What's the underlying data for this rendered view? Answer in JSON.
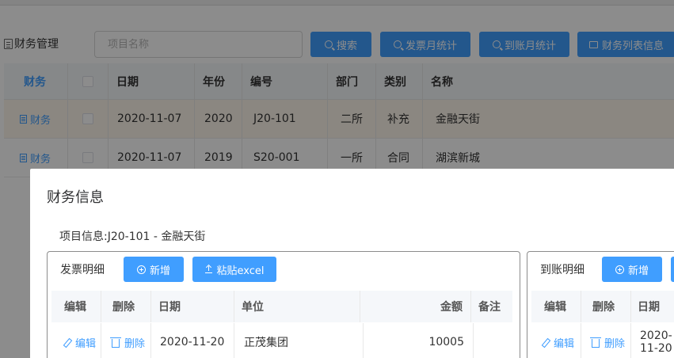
{
  "toolbar": {
    "module_title": "财务管理",
    "search_placeholder": "项目名称",
    "search_button": "搜索",
    "invoice_monthly_button": "发票月统计",
    "arrival_monthly_button": "到账月统计",
    "finance_list_button": "财务列表信息"
  },
  "main_table": {
    "headers": {
      "action": "财务",
      "date": "日期",
      "year": "年份",
      "code": "编号",
      "dept": "部门",
      "category": "类别",
      "name": "名称"
    },
    "rows": [
      {
        "action": "财务",
        "date": "2020-11-07",
        "year": "2020",
        "code": "J20-101",
        "dept": "二所",
        "category": "补充",
        "name": "金融天街"
      },
      {
        "action": "财务",
        "date": "2020-11-07",
        "year": "2019",
        "code": "S20-001",
        "dept": "一所",
        "category": "合同",
        "name": "湖滨新城"
      }
    ]
  },
  "dialog": {
    "title": "财务信息",
    "project_info": "项目信息:J20-101 - 金融天街",
    "invoice_panel": {
      "title": "发票明细",
      "add_button": "新增",
      "paste_button": "粘贴excel",
      "headers": {
        "edit": "编辑",
        "delete": "删除",
        "date": "日期",
        "unit": "单位",
        "amount": "金额",
        "remark": "备注"
      },
      "rows": [
        {
          "edit": "编辑",
          "delete": "删除",
          "date": "2020-11-20",
          "unit": "正茂集团",
          "amount": "10005",
          "remark": ""
        }
      ]
    },
    "arrival_panel": {
      "title": "到账明细",
      "add_button": "新增",
      "headers": {
        "edit": "编辑",
        "delete": "删除",
        "date": "日期"
      },
      "rows": [
        {
          "edit": "编辑",
          "delete": "删除",
          "date": "2020-11-20"
        }
      ]
    }
  },
  "colors": {
    "primary": "#409eff",
    "highlight_row": "#fdf6ec",
    "overlay": "rgba(0,0,0,0.45)"
  }
}
